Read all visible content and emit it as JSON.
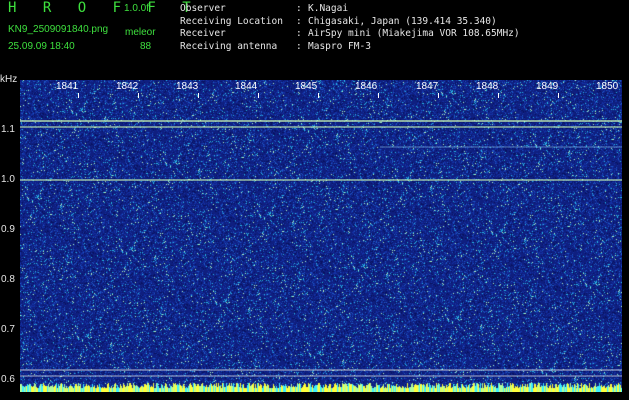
{
  "header": {
    "title": "H R O F F T",
    "version": "1.0.0f",
    "filename": "KN9_2509091840.png",
    "meleor_label": "meleor",
    "datetime": "25.09.09 18:40",
    "count": "88"
  },
  "info": [
    {
      "key": "Observer",
      "sep": ":",
      "value": "K.Nagai"
    },
    {
      "key": "Receiving Location",
      "sep": ":",
      "value": "Chigasaki, Japan (139.414 35.340)"
    },
    {
      "key": "Receiver",
      "sep": ":",
      "value": "AirSpy mini (Miakejima VOR 108.65MHz)"
    },
    {
      "key": "Receiving antenna",
      "sep": ":",
      "value": "Maspro FM-3"
    }
  ],
  "axis": {
    "unit": "kHz",
    "freq_ticks": [
      "1.1",
      "1.0",
      "0.9",
      "0.8",
      "0.7",
      "0.6"
    ],
    "minute_ticks": [
      "1841",
      "1842",
      "1843",
      "1844",
      "1845",
      "1846",
      "1847",
      "1848",
      "1849",
      "1850"
    ]
  },
  "colors": {
    "background": "#0f1f80",
    "signal": "#c8ffb4",
    "text_green": "#3ee03e",
    "text_white": "#e6e6e6",
    "bottom_strip": "#ffff3c"
  }
}
